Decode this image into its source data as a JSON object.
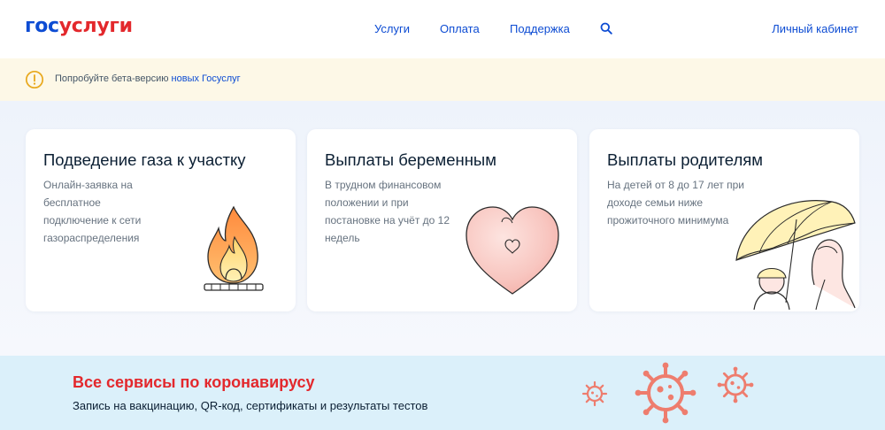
{
  "header": {
    "logo_part1": "гос",
    "logo_part2": "услуги",
    "nav": [
      "Услуги",
      "Оплата",
      "Поддержка"
    ],
    "search_icon": "search-icon",
    "cabinet_label": "Личный кабинет"
  },
  "beta": {
    "icon": "warning-circle-icon",
    "text": "Попробуйте бета-версию",
    "link": "новых Госуслуг"
  },
  "cards": [
    {
      "title": "Подведение газа к участку",
      "desc": "Онлайн-заявка на бесплатное подключение к сети газораспределения",
      "illustration": "gas-flame-icon"
    },
    {
      "title": "Выплаты беременным",
      "desc": "В трудном финансовом положении и при постановке на учёт до 12 недель",
      "illustration": "heart-icon"
    },
    {
      "title": "Выплаты родителям",
      "desc": "На детей от 8 до 17 лет при доходе семьи ниже прожиточного минимума",
      "illustration": "umbrella-family-icon"
    }
  ],
  "covid": {
    "title": "Все сервисы по коронавирусу",
    "subtitle": "Запись на вакцинацию, QR-код, сертификаты и результаты тестов",
    "icon": "virus-icon"
  },
  "colors": {
    "brand_blue": "#0d4cd3",
    "brand_red": "#e3282c",
    "beta_bg": "#fdf8e7",
    "covid_bg": "#dbf0fa",
    "virus": "#ee7d6e"
  }
}
